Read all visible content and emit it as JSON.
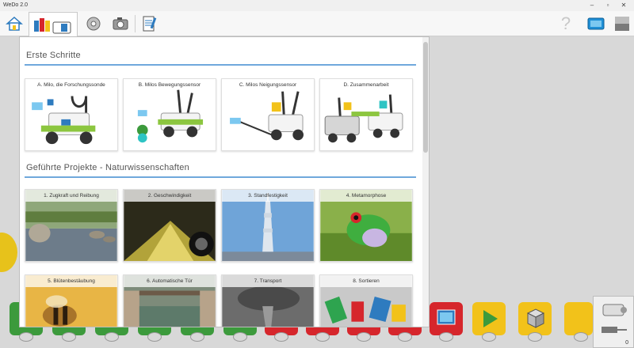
{
  "window": {
    "title": "WeDo 2.0"
  },
  "toolbar": {
    "home_icon": "home-icon",
    "help_glyph": "?"
  },
  "dialog": {
    "sections": [
      {
        "title": "Erste Schritte",
        "cards": [
          {
            "label": "A. Milo, die Forschungssonde"
          },
          {
            "label": "B. Milos Bewegungssensor"
          },
          {
            "label": "C. Milos Neigungssensor"
          },
          {
            "label": "D. Zusammenarbeit"
          }
        ]
      },
      {
        "title": "Geführte Projekte - Naturwissenschaften",
        "cards": [
          {
            "label": "1. Zugkraft und Reibung"
          },
          {
            "label": "2. Geschwindigkeit"
          },
          {
            "label": "3. Standfestigkeit"
          },
          {
            "label": "4. Metamorphose"
          },
          {
            "label": "5. Blütenbestäubung"
          },
          {
            "label": "6. Automatische Tür"
          },
          {
            "label": "7. Transport"
          },
          {
            "label": "8. Sortieren"
          }
        ]
      }
    ]
  },
  "status": {
    "counter": "0"
  },
  "colors": {
    "accent_rule": "#6fa8dc",
    "palette_green": "#3c9a3c",
    "palette_red": "#d6262c",
    "palette_yellow": "#f2c21a"
  }
}
